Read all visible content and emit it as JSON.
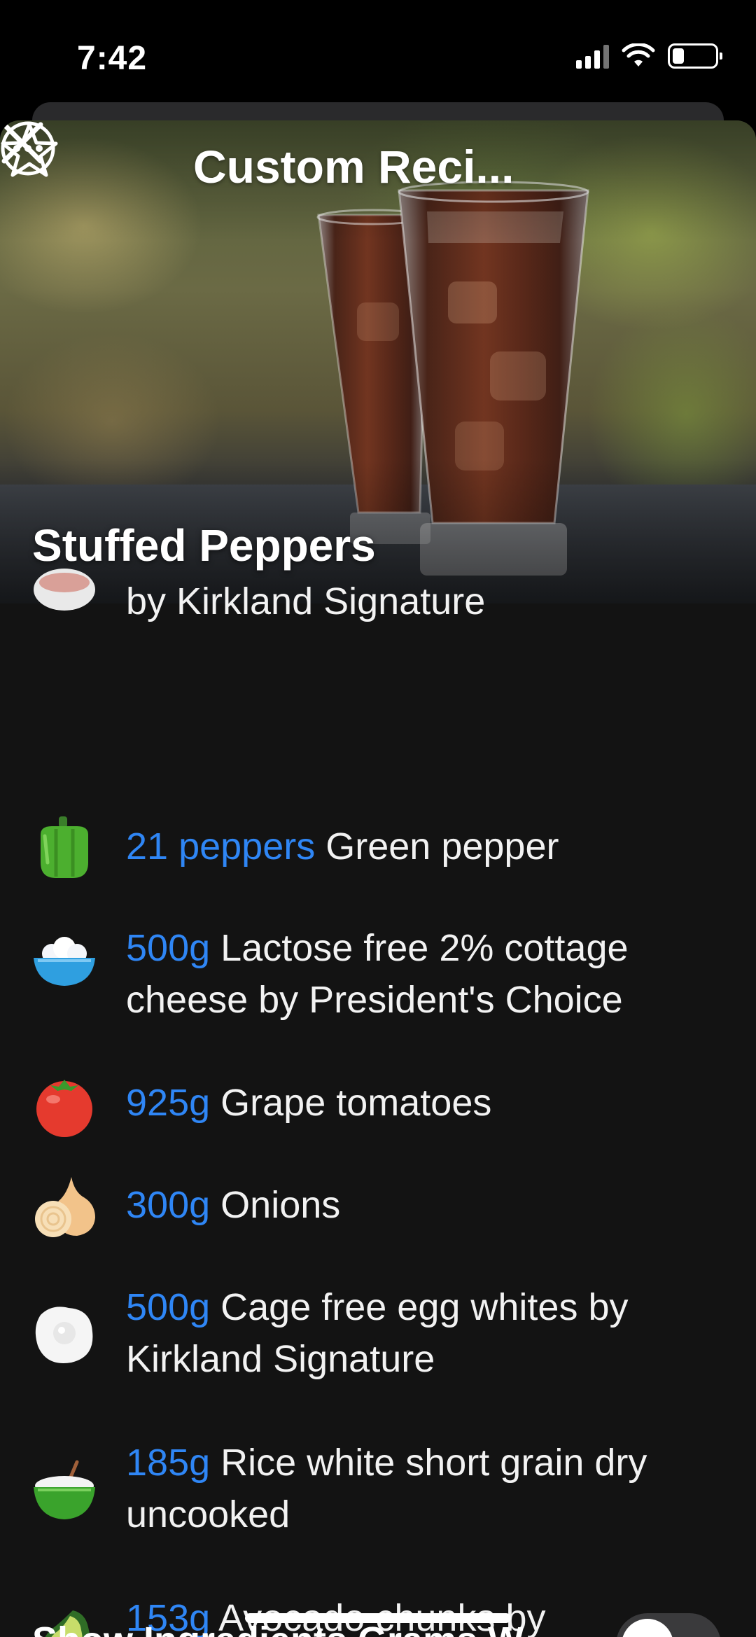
{
  "status_bar": {
    "time": "7:42"
  },
  "nav": {
    "title": "Custom Reci...",
    "close_icon": "close-icon",
    "star_icon": "star-icon",
    "more_icon": "more-icon"
  },
  "recipe": {
    "title": "Stuffed Peppers"
  },
  "ingredients": [
    {
      "amount": "",
      "name": "by Kirkland Signature",
      "icon": "bowl-icon"
    },
    {
      "amount": "21 peppers",
      "name": "Green pepper",
      "icon": "green-pepper-icon"
    },
    {
      "amount": "500g",
      "name": "Lactose free 2% cottage cheese by President's Choice",
      "icon": "cottage-cheese-icon"
    },
    {
      "amount": "925g",
      "name": "Grape tomatoes",
      "icon": "tomato-icon"
    },
    {
      "amount": "300g",
      "name": "Onions",
      "icon": "onion-icon"
    },
    {
      "amount": "500g",
      "name": "Cage free egg whites by Kirkland Signature",
      "icon": "egg-icon"
    },
    {
      "amount": "185g",
      "name": "Rice white short grain dry uncooked",
      "icon": "rice-bowl-icon"
    },
    {
      "amount": "153g",
      "name": "Avocado chunks by President's Choice",
      "icon": "avocado-icon"
    }
  ],
  "footer": {
    "label": "Show Ingredients Grams W..."
  },
  "colors": {
    "background": "#131313",
    "accent": "#2f86f5",
    "text": "#f2f2f2"
  }
}
